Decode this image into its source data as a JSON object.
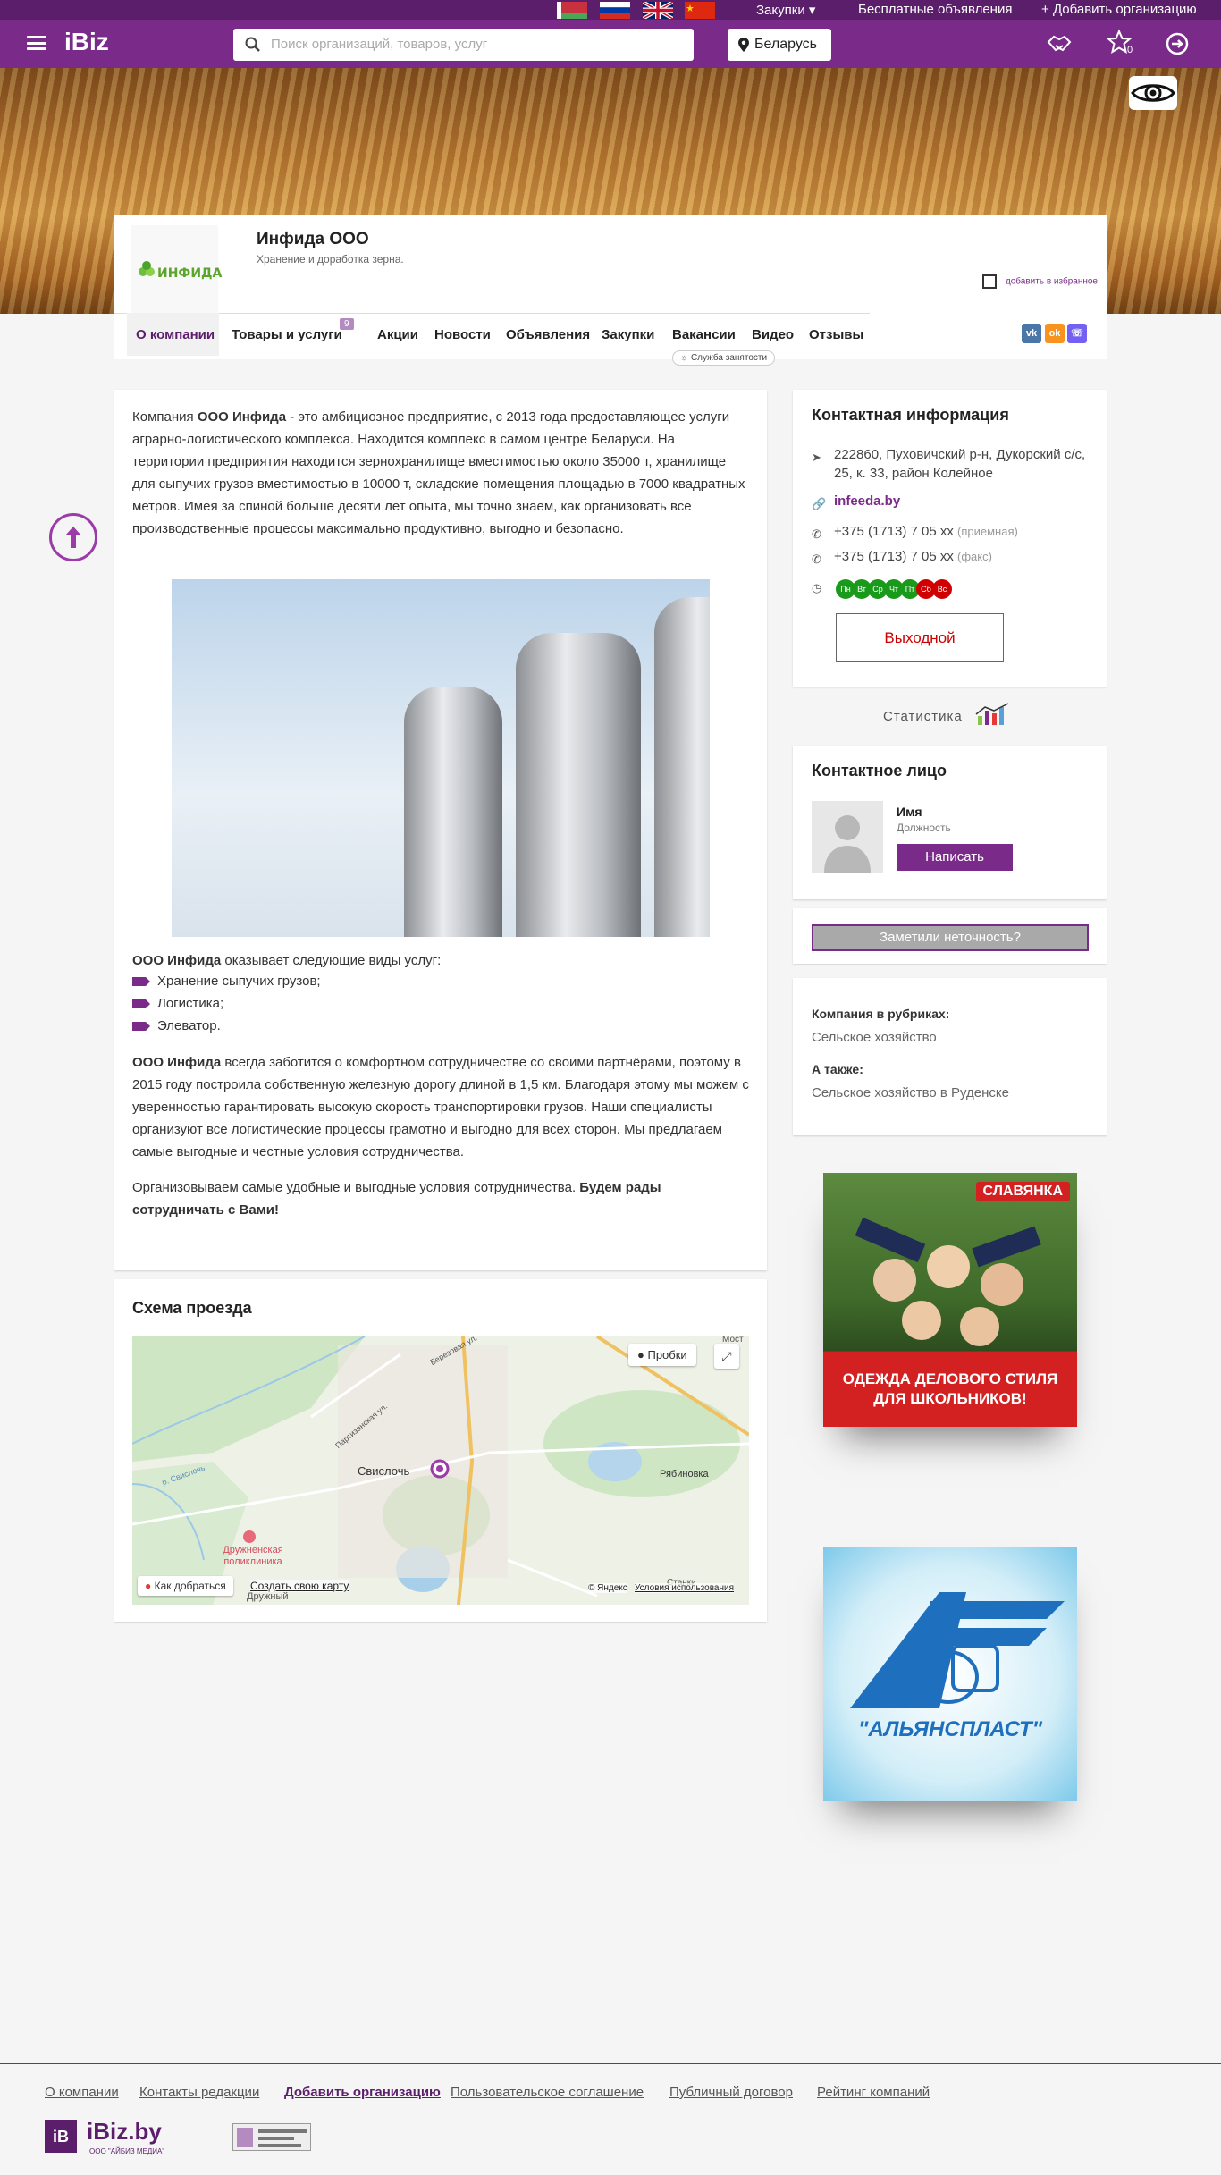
{
  "topbar": {
    "purchases": "Закупки",
    "free_ads": "Бесплатные объявления",
    "add_org": "Добавить организацию"
  },
  "header": {
    "logo": "iBiz",
    "search_placeholder": "Поиск организаций, товаров, услуг",
    "region": "Беларусь",
    "favorites_count": "0"
  },
  "company": {
    "name": "Инфида ООО",
    "description": "Хранение и доработка зерна.",
    "logo_text": "ИНФИДА",
    "add_favorite": "добавить в избранное",
    "tabs": [
      {
        "label": "О компании"
      },
      {
        "label": "Товары и услуги",
        "badge": "9"
      },
      {
        "label": "Акции"
      },
      {
        "label": "Новости"
      },
      {
        "label": "Объявления"
      },
      {
        "label": "Закупки"
      },
      {
        "label": "Вакансии"
      },
      {
        "label": "Видео"
      },
      {
        "label": "Отзывы"
      }
    ],
    "employment_service": "Служба занятости",
    "social": [
      "vk",
      "ok",
      "viber"
    ]
  },
  "about": {
    "intro_prefix": "Компания ",
    "intro_bold": "ООО Инфида",
    "intro_rest": " - это амбициозное предприятие, с 2013 года предоставляющее услуги аграрно-логистического комплекса. Находится комплекс в самом центре Беларуси. На территории предприятия находится зернохранилище вместимостью около 35000 т, хранилище для сыпучих грузов вместимостью в 10000 т, складские помещения площадью в 7000 квадратных метров. Имея за спиной больше десяти лет опыта, мы точно знаем, как организовать все производственные процессы максимально продуктивно, выгодно и безопасно.",
    "services_bold": "ООО Инфида",
    "services_rest": " оказывает следующие виды услуг:",
    "services": [
      "Хранение сыпучих грузов;",
      "Логистика;",
      "Элеватор."
    ],
    "partner_bold": "ООО Инфида",
    "partner_rest": " всегда заботится о комфортном сотрудничестве со своими партнёрами, поэтому в 2015 году построила собственную железную дорогу длиной в 1,5 км. Благодаря этому мы можем с уверенностью гарантировать высокую скорость транспортировки грузов. Наши специалисты организуют все логистические процессы грамотно и выгодно для всех сторон. Мы предлагаем самые выгодные и честные условия сотрудничества.",
    "closing_rest": "Организовываем самые удобные и выгодные условия сотрудничества. ",
    "closing_bold": "Будем рады сотрудничать с Вами!"
  },
  "map": {
    "title": "Схема проезда",
    "traffic": "Пробки",
    "route": "Как добраться",
    "create_map": "Создать свою карту",
    "copyright": "© Яндекс",
    "terms": "Условия использования",
    "labels": {
      "svisloch": "Свислочь",
      "rybinovka": "Рябиновка",
      "clinic": "Дружненская поликлиника",
      "partizanskaya": "Партизанская ул.",
      "berezovaya": "Березовая ул.",
      "most": "Мост",
      "stanki": "Станки",
      "druzhny": "Дружный",
      "svisloch_river": "р. Свислочь"
    }
  },
  "contacts": {
    "title": "Контактная информация",
    "address": "222860, Пуховичский р-н, Дукорский с/с, 25, к. 33, район Колейное",
    "website": "infeeda.by",
    "phone1": "+375 (1713) 7 05 xx",
    "phone1_note": "(приемная)",
    "phone2": "+375 (1713) 7 05 xx",
    "phone2_note": "(факс)",
    "days": [
      {
        "d": "Пн",
        "color": "#1a9a1a"
      },
      {
        "d": "Вт",
        "color": "#1a9a1a"
      },
      {
        "d": "Ср",
        "color": "#1a9a1a"
      },
      {
        "d": "Чт",
        "color": "#1a9a1a"
      },
      {
        "d": "Пт",
        "color": "#1a9a1a"
      },
      {
        "d": "Сб",
        "color": "#d10000"
      },
      {
        "d": "Вс",
        "color": "#d10000"
      }
    ],
    "status": "Выходной"
  },
  "statistics": "Статистика",
  "contact_person": {
    "title": "Контактное лицо",
    "name": "Имя",
    "position": "Должность",
    "write": "Написать"
  },
  "report_error": "Заметили неточность?",
  "rubrics": {
    "title": "Компания в рубриках",
    "item": "Сельское хозяйство",
    "also_title": "А также",
    "also_item": "Сельское хозяйство в Руденске"
  },
  "ads": [
    {
      "brand": "СЛАВЯНКА",
      "caption": "ОДЕЖДА ДЕЛОВОГО СТИЛЯ ДЛЯ ШКОЛЬНИКОВ!"
    },
    {
      "brand": "\"АЛЬЯНСПЛАСТ\""
    }
  ],
  "footer": {
    "links": [
      "О компании",
      "Контакты редакции",
      "Добавить организацию",
      "Пользовательское соглашение",
      "Публичный договор",
      "Рейтинг компаний"
    ],
    "logo": "iBiz.by",
    "logo_sub": "ООО \"АЙБИЗ МЕДИА\""
  },
  "colors": {
    "brand": "#7a2b8a",
    "brand_dark": "#5b1e6b",
    "green": "#1a9a1a",
    "red": "#d10000"
  }
}
